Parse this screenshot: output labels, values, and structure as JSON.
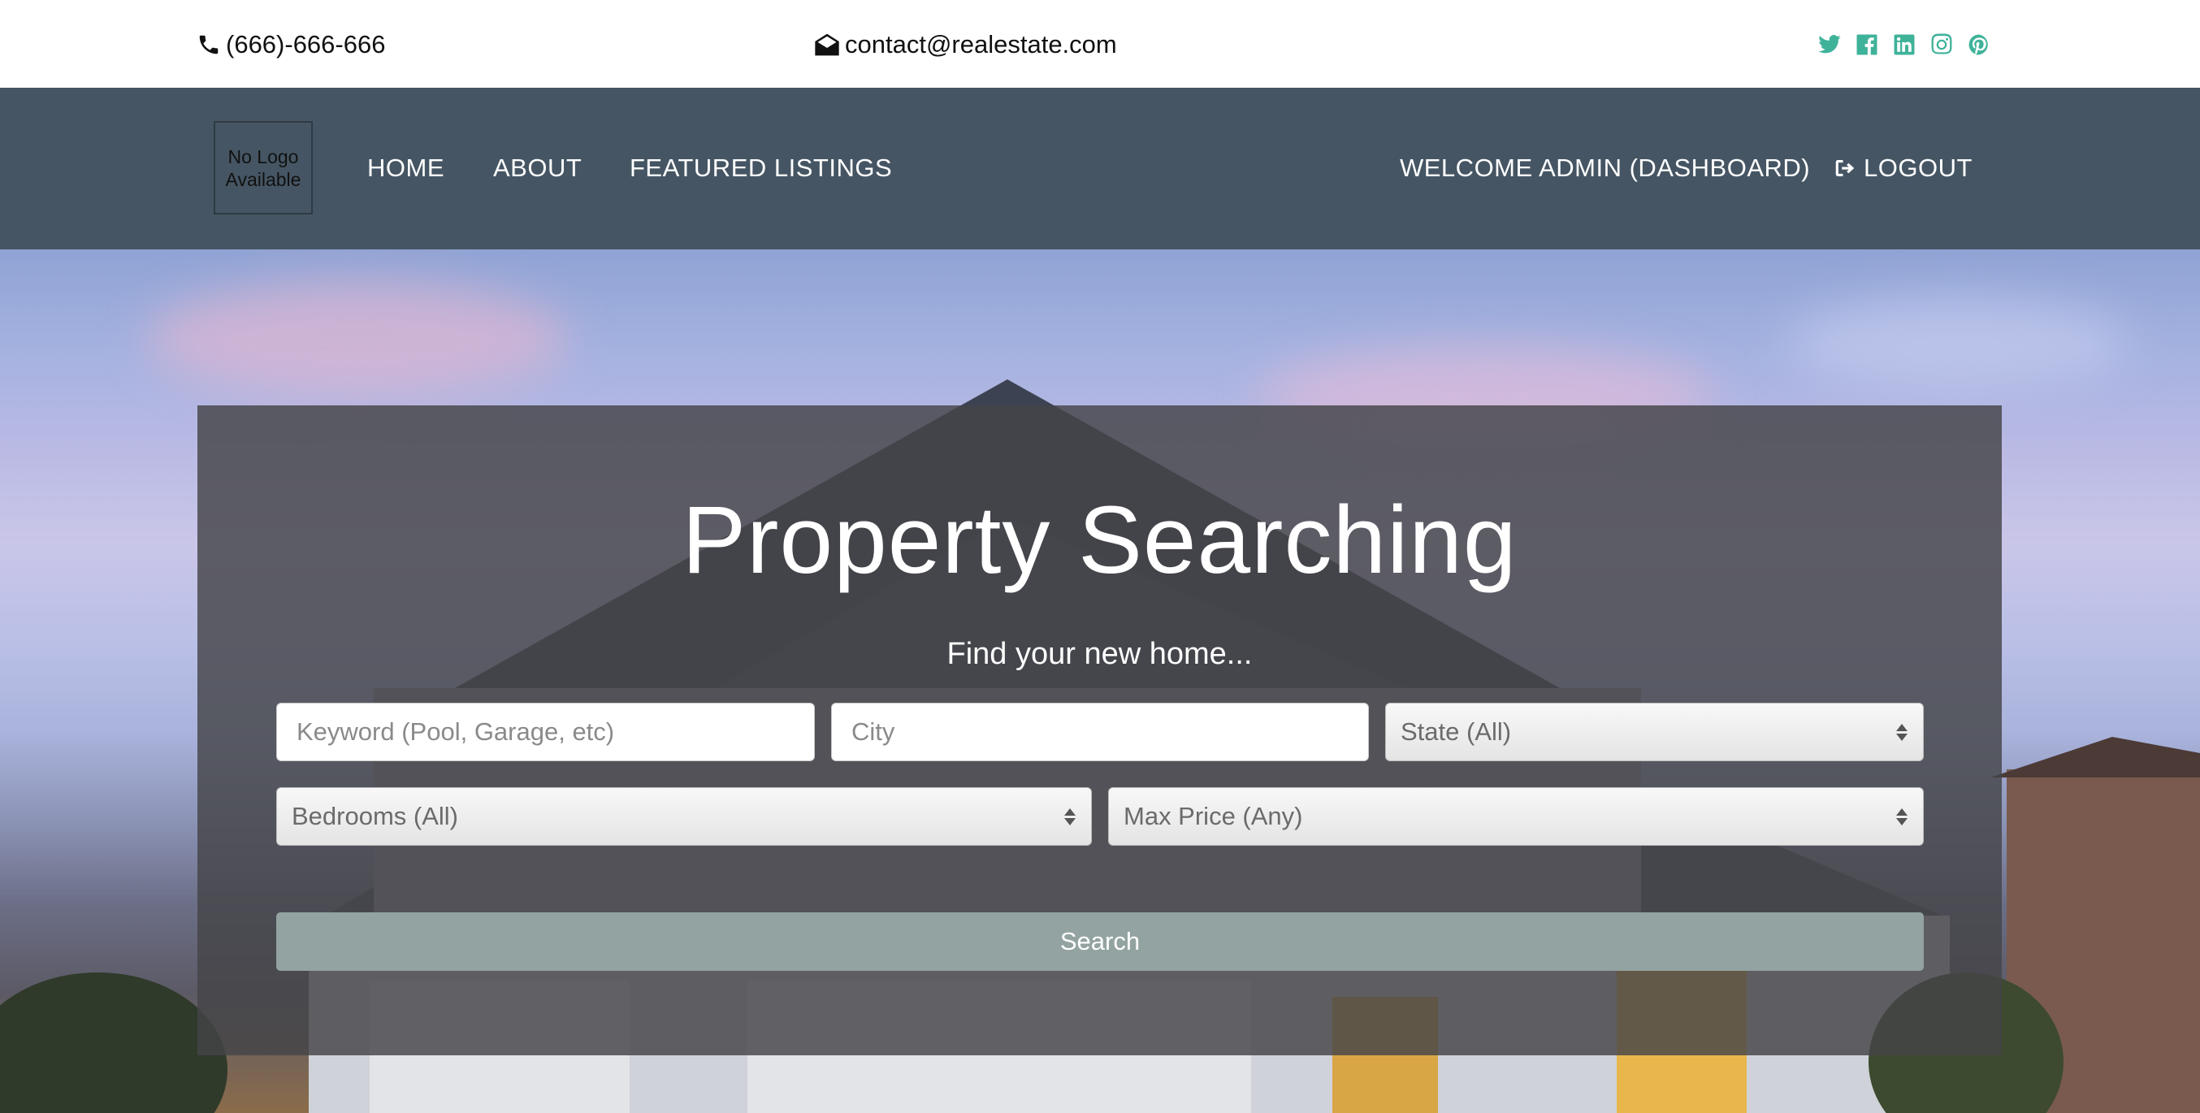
{
  "topbar": {
    "phone": "(666)-666-666",
    "email": "contact@realestate.com",
    "socials": [
      "twitter-icon",
      "facebook-icon",
      "linkedin-icon",
      "instagram-icon",
      "pinterest-icon"
    ]
  },
  "navbar": {
    "logo_text": "No Logo Available",
    "links": {
      "home": "HOME",
      "about": "ABOUT",
      "featured": "FEATURED LISTINGS",
      "welcome": "WELCOME ADMIN (DASHBOARD)",
      "logout": "LOGOUT"
    }
  },
  "search": {
    "title": "Property Searching",
    "subtitle": "Find your new home...",
    "keyword_placeholder": "Keyword (Pool, Garage, etc)",
    "keyword_value": "",
    "city_placeholder": "City",
    "city_value": "",
    "state_selected": "State (All)",
    "bedrooms_selected": "Bedrooms (All)",
    "max_price_selected": "Max Price (Any)",
    "button_label": "Search"
  },
  "colors": {
    "navbar_bg": "#455563",
    "social_accent": "#3fb39a",
    "search_button": "#93a3a1",
    "panel_overlay": "rgba(68,68,72,0.82)"
  }
}
